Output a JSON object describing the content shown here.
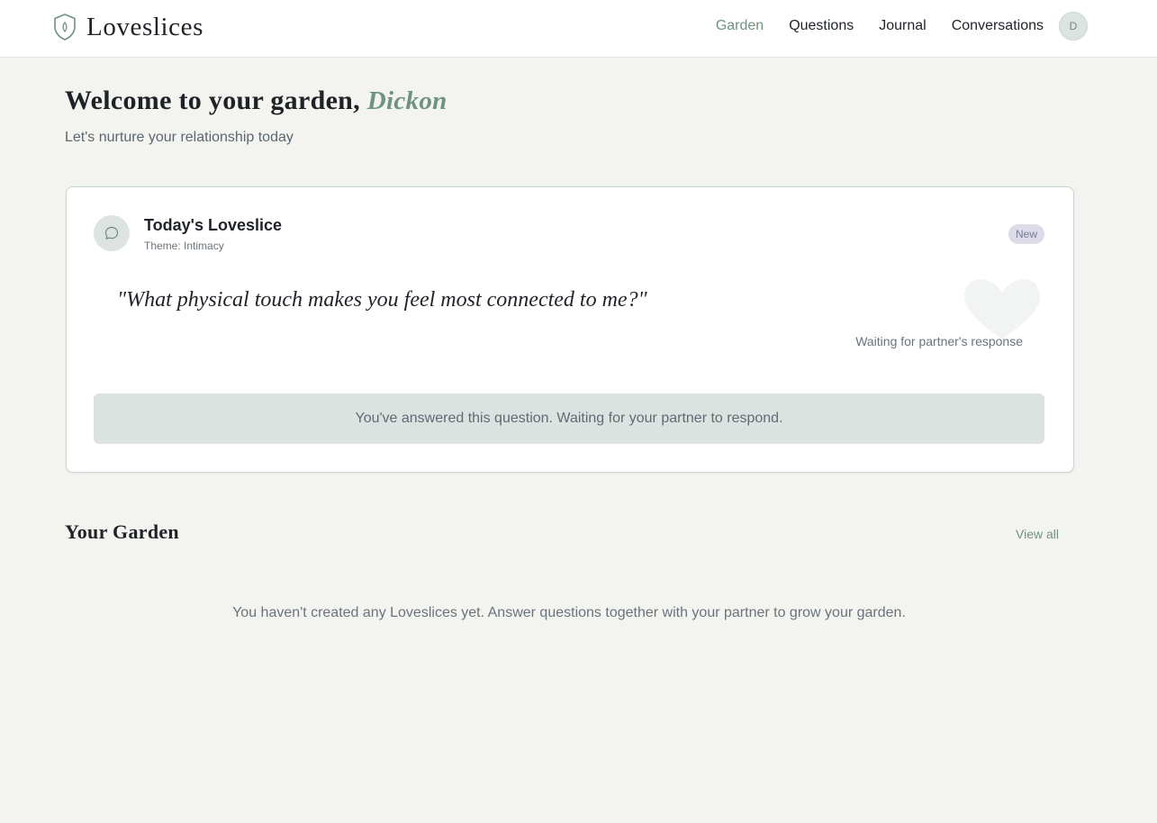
{
  "app": {
    "name": "Loveslices",
    "brand_icon": "shield-leaf-icon",
    "colors": {
      "accent": "#6f9281",
      "background": "#f3f4ef",
      "badge_bg": "#dcdbe9",
      "status_bg": "#dbe2e0"
    }
  },
  "nav": {
    "items": [
      {
        "label": "Garden",
        "active": true
      },
      {
        "label": "Questions",
        "active": false
      },
      {
        "label": "Journal",
        "active": false
      },
      {
        "label": "Conversations",
        "active": false
      }
    ],
    "avatar_initial": "D"
  },
  "welcome": {
    "prefix": "Welcome to your garden,",
    "name": "Dickon",
    "subtitle": "Let's nurture your relationship today"
  },
  "card": {
    "icon": "speech-bubble-icon",
    "title": "Today's Loveslice",
    "theme": "Theme: Intimacy",
    "badge": "New",
    "question": "\"What physical touch makes you feel most connected to me?\"",
    "heart_icon": "heart-icon",
    "waiting": "Waiting for partner's response",
    "status": "You've answered this question. Waiting for your partner to respond."
  },
  "garden": {
    "title": "Your Garden",
    "view_all": "View all",
    "empty_message": "You haven't created any Loveslices yet. Answer questions together with your partner to grow your garden."
  }
}
